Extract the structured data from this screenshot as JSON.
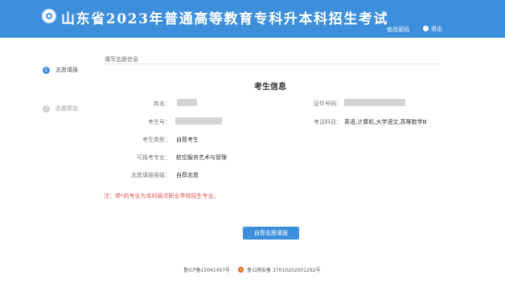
{
  "header": {
    "title": "山东省2023年普通高等教育专科升本科招生考试",
    "change_password": "修改密码",
    "logout": "退出"
  },
  "steps": [
    {
      "num": "1",
      "label": "志愿填报"
    },
    {
      "num": "2",
      "label": "志愿预览"
    }
  ],
  "section_title": "填写志愿信息",
  "form_title": "考生信息",
  "fields": {
    "name_label": "姓名：",
    "id_label": "证件号码：",
    "exam_no_label": "考生号：",
    "subjects_label": "考试科目：",
    "subjects_value": "英语,计算机,大学语文,高等数学Ⅲ",
    "type_label": "考生类型：",
    "type_value": "自荐考生",
    "major_label": "可报考专业：",
    "major_value": "航空服务艺术与管理",
    "level_label": "志愿填报层级：",
    "level_value": "自荐志愿"
  },
  "note": "注：带*的专业为本科层次职业学校招生专业。",
  "submit_button": "自荐志愿填报",
  "footer": {
    "icp": "鲁ICP备15041457号",
    "police": "鲁公网安备 37010202001292号"
  },
  "colors": {
    "header_bg": "#3d8fdc",
    "accent": "#3d8fdc",
    "note": "#e05151"
  },
  "icons": {
    "logo": "site-logo-icon",
    "logout": "logout-icon",
    "police": "police-badge-icon"
  }
}
